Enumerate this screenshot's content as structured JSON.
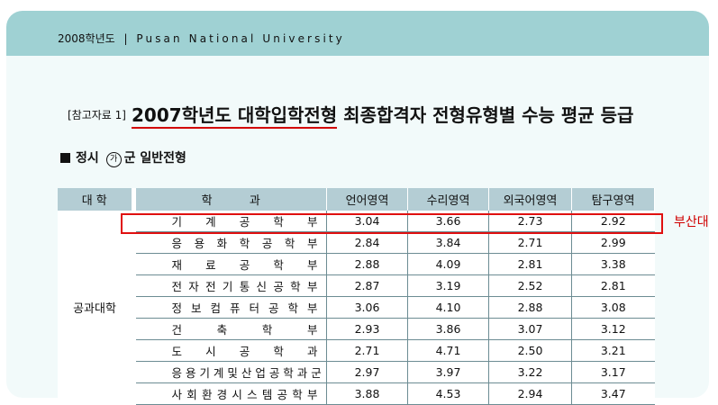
{
  "header": {
    "year": "2008학년도",
    "separator": "|",
    "university": "Pusan National University"
  },
  "title": {
    "ref": "[참고자료 1]",
    "part1": "2007학년도 ",
    "part2": "대학입학전형",
    "part3": " 최종합격자 전형유형별 수능 평균 등급"
  },
  "section": {
    "prefix": "정시",
    "circle": "가",
    "suffix": "군 일반전형"
  },
  "table": {
    "headers": [
      "대  학",
      "학          과",
      "언어영역",
      "수리영역",
      "외국어영역",
      "탐구영역"
    ],
    "university": "공과대학",
    "rows": [
      {
        "dept": "기 계 공 학 부",
        "v": [
          "3.04",
          "3.66",
          "2.73",
          "2.92"
        ]
      },
      {
        "dept": "응 용 화 학 공 학 부",
        "v": [
          "2.84",
          "3.84",
          "2.71",
          "2.99"
        ]
      },
      {
        "dept": "재 료 공 학 부",
        "v": [
          "2.88",
          "4.09",
          "2.81",
          "3.38"
        ]
      },
      {
        "dept": "전자전기통신공학부",
        "v": [
          "2.87",
          "3.19",
          "2.52",
          "2.81"
        ]
      },
      {
        "dept": "정 보 컴 퓨 터 공 학 부",
        "v": [
          "3.06",
          "4.10",
          "2.88",
          "3.08"
        ]
      },
      {
        "dept": "건 축 학 부",
        "v": [
          "2.93",
          "3.86",
          "3.07",
          "3.12"
        ]
      },
      {
        "dept": "도 시 공 학 과",
        "v": [
          "2.71",
          "4.71",
          "2.50",
          "3.21"
        ]
      },
      {
        "dept": "응용기계및산업공학과군",
        "v": [
          "2.97",
          "3.97",
          "3.22",
          "3.17"
        ]
      },
      {
        "dept": "사회환경시스템공학부",
        "v": [
          "3.88",
          "4.53",
          "2.94",
          "3.47"
        ]
      }
    ]
  },
  "annotation": {
    "label": "부산대",
    "color": "#e01010"
  }
}
